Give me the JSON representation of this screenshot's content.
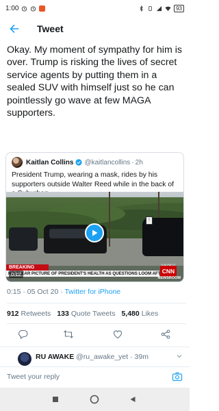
{
  "status_bar": {
    "time": "1:00",
    "battery": "93"
  },
  "header": {
    "title": "Tweet"
  },
  "tweet": {
    "text": "Okay. My moment of sympathy for him is over. Trump is risking the lives of secret service agents by putting them in a sealed SUV with himself just so he can pointlessly go wave at few MAGA supporters.",
    "time": "0:15 · 05 Oct 20 · ",
    "client": "Twitter for iPhone"
  },
  "quote": {
    "name": "Kaitlan Collins",
    "handle": "@kaitlancollins",
    "dot": "·",
    "age": "2h",
    "text": "President Trump, wearing a mask, rides by his supporters outside Walter Reed while in the back of a Suburban.",
    "video": {
      "breaking": "BREAKING NEWS",
      "headline": "NO CLEAR PICTURE OF PRESIDENT'S HEALTH AS QUESTIONS LOOM AFTER BRIEFING",
      "network": "CNN",
      "network_time": "5:30 PM CT",
      "newsroom": "NEWSROOM",
      "duration": "0:12"
    }
  },
  "stats": {
    "retweets_count": "912",
    "retweets_label": "Retweets",
    "quotes_count": "133",
    "quotes_label": "Quote Tweets",
    "likes_count": "5,480",
    "likes_label": "Likes"
  },
  "reply": {
    "name": "RU AWAKE",
    "handle": "@ru_awake_yet",
    "dot": "·",
    "age": "39m"
  },
  "composer": {
    "placeholder": "Tweet your reply"
  },
  "colors": {
    "accent": "#1da1f2",
    "text": "#14171a",
    "secondary": "#657786",
    "breaking_red": "#c40c15"
  }
}
